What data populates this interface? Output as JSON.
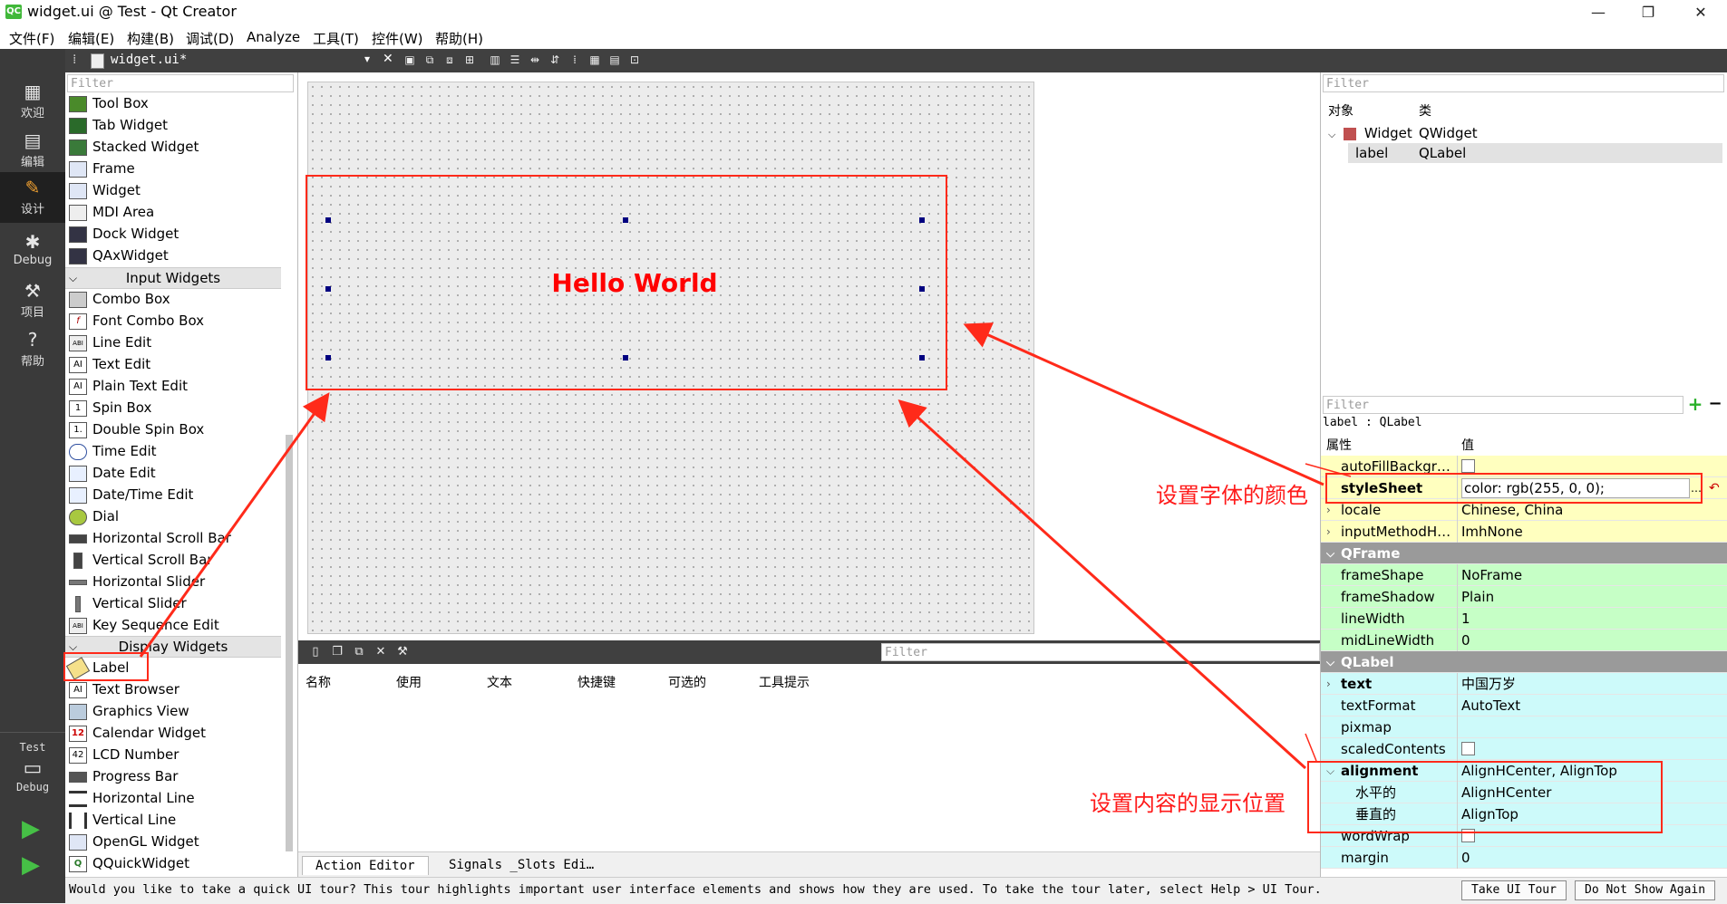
{
  "window": {
    "app_icon": "QC",
    "title": "widget.ui @ Test - Qt Creator",
    "min": "—",
    "restore": "❐",
    "close": "✕"
  },
  "menu": [
    "文件(F)",
    "编辑(E)",
    "构建(B)",
    "调试(D)",
    "Analyze",
    "工具(T)",
    "控件(W)",
    "帮助(H)"
  ],
  "modes": [
    {
      "label": "欢迎",
      "icon": "grid-icon",
      "glyph": "▦"
    },
    {
      "label": "编辑",
      "icon": "document-icon",
      "glyph": "▤"
    },
    {
      "label": "设计",
      "icon": "pencil-icon",
      "glyph": "✎"
    },
    {
      "label": "Debug",
      "icon": "bug-icon",
      "glyph": "✱"
    },
    {
      "label": "项目",
      "icon": "wrench-icon",
      "glyph": "⚒"
    },
    {
      "label": "帮助",
      "icon": "help-icon",
      "glyph": "?"
    }
  ],
  "kit": {
    "project": "Test",
    "config": "Debug"
  },
  "document": {
    "name": "widget.ui*"
  },
  "widgetbox": {
    "filter_placeholder": "Filter",
    "containers": [
      "Tool Box",
      "Tab Widget",
      "Stacked Widget",
      "Frame",
      "Widget",
      "MDI Area",
      "Dock Widget",
      "QAxWidget"
    ],
    "input_category": "Input Widgets",
    "input_widgets": [
      "Combo Box",
      "Font Combo Box",
      "Line Edit",
      "Text Edit",
      "Plain Text Edit",
      "Spin Box",
      "Double Spin Box",
      "Time Edit",
      "Date Edit",
      "Date/Time Edit",
      "Dial",
      "Horizontal Scroll Bar",
      "Vertical Scroll Bar",
      "Horizontal Slider",
      "Vertical Slider",
      "Key Sequence Edit"
    ],
    "display_category": "Display Widgets",
    "display_widgets": [
      "Label",
      "Text Browser",
      "Graphics View",
      "Calendar Widget",
      "LCD Number",
      "Progress Bar",
      "Horizontal Line",
      "Vertical Line",
      "OpenGL Widget",
      "QQuickWidget"
    ]
  },
  "canvas": {
    "label_text": "Hello World",
    "label_color": "#ff0000"
  },
  "action_editor": {
    "filter_placeholder": "Filter",
    "columns": [
      "名称",
      "使用",
      "文本",
      "快捷键",
      "可选的",
      "工具提示"
    ],
    "tabs": [
      "Action Editor",
      "Signals _Slots Edi…"
    ]
  },
  "object_inspector": {
    "filter_placeholder": "Filter",
    "col_object": "对象",
    "col_class": "类",
    "rows": [
      {
        "object": "Widget",
        "class": "QWidget"
      },
      {
        "object": "label",
        "class": "QLabel"
      }
    ]
  },
  "property_editor": {
    "filter_placeholder": "Filter",
    "header": "label : QLabel",
    "col_property": "属性",
    "col_value": "值",
    "rows": [
      {
        "name": "autoFillBackgr…",
        "value": "",
        "check": true
      },
      {
        "name": "styleSheet",
        "value": "color: rgb(255, 0, 0);"
      },
      {
        "name": "locale",
        "value": "Chinese, China"
      },
      {
        "name": "inputMethodH…",
        "value": "ImhNone"
      },
      {
        "name": "QFrame",
        "value": ""
      },
      {
        "name": "frameShape",
        "value": "NoFrame"
      },
      {
        "name": "frameShadow",
        "value": "Plain"
      },
      {
        "name": "lineWidth",
        "value": "1"
      },
      {
        "name": "midLineWidth",
        "value": "0"
      },
      {
        "name": "QLabel",
        "value": ""
      },
      {
        "name": "text",
        "value": "中国万岁"
      },
      {
        "name": "textFormat",
        "value": "AutoText"
      },
      {
        "name": "pixmap",
        "value": ""
      },
      {
        "name": "scaledContents",
        "value": "",
        "check": true
      },
      {
        "name": "alignment",
        "value": "AlignHCenter, AlignTop"
      },
      {
        "name": "水平的",
        "value": "AlignHCenter"
      },
      {
        "name": "垂直的",
        "value": "AlignTop"
      },
      {
        "name": "wordWrap",
        "value": "",
        "check": true
      },
      {
        "name": "margin",
        "value": "0"
      }
    ]
  },
  "annotations": {
    "font_color": "设置字体的颜色",
    "display_position": "设置内容的显示位置"
  },
  "status": {
    "message": "Would you like to take a quick UI tour? This tour highlights important user interface elements and shows how they are used. To take the tour later, select Help > UI Tour.",
    "take_tour": "Take UI Tour",
    "dont_show": "Do Not Show Again"
  }
}
